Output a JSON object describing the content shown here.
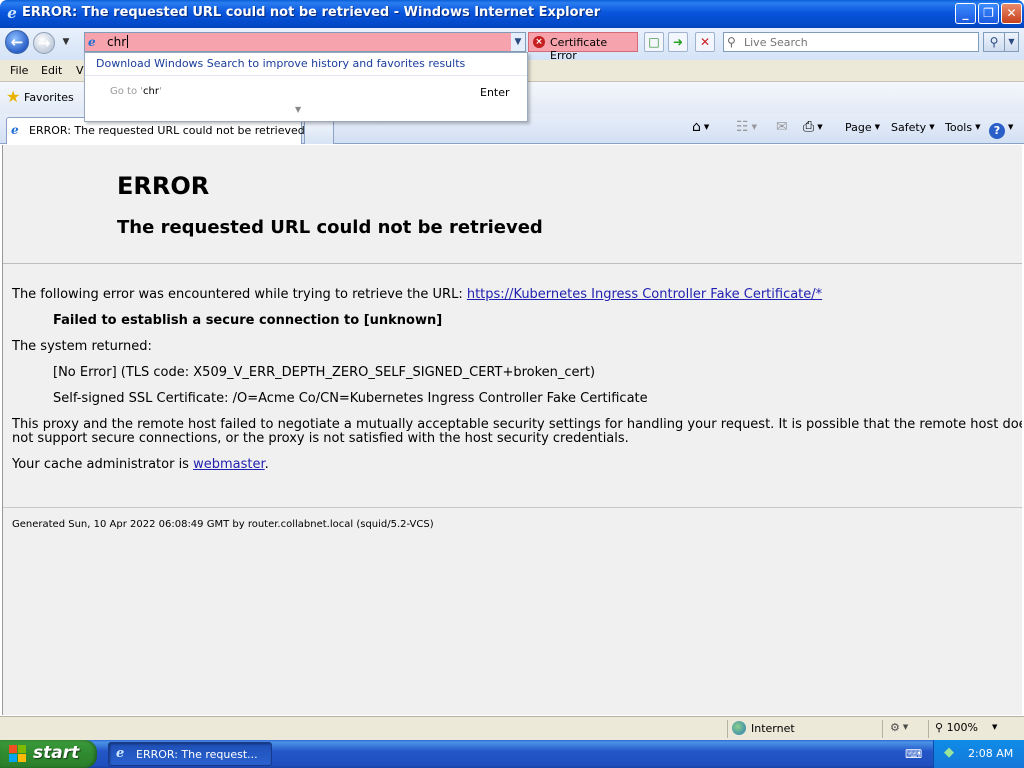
{
  "window": {
    "title": "ERROR: The requested URL could not be retrieved - Windows Internet Explorer",
    "controls": {
      "minimize": "_",
      "maximize": "❐",
      "close": "✕"
    }
  },
  "address_bar": {
    "value": "chr",
    "certificate_label": "Certificate Error"
  },
  "search": {
    "placeholder": "Live Search"
  },
  "autocomplete": {
    "hint": "Download Windows Search to improve history and favorites results",
    "goto_prefix": "Go to '",
    "goto_value": "chr",
    "goto_suffix": "'",
    "enter_label": "Enter"
  },
  "menu": {
    "file": "File",
    "edit": "Edit",
    "view": "Vi"
  },
  "favorites": {
    "label": "Favorites"
  },
  "tab": {
    "label": "ERROR: The requested URL could not be retrieved"
  },
  "command_bar": {
    "page": "Page",
    "safety": "Safety",
    "tools": "Tools"
  },
  "page": {
    "heading": "ERROR",
    "subheading": "The requested URL could not be retrieved",
    "intro": "The following error was encountered while trying to retrieve the URL: ",
    "url_link": "https://Kubernetes Ingress Controller Fake Certificate/*",
    "failure": "Failed to establish a secure connection to [unknown]",
    "system_returned": "The system returned:",
    "tls_error": "[No Error] (TLS code: X509_V_ERR_DEPTH_ZERO_SELF_SIGNED_CERT+broken_cert)",
    "self_signed": "Self-signed SSL Certificate: /O=Acme Co/CN=Kubernetes Ingress Controller Fake Certificate",
    "explanation_line1": "This proxy and the remote host failed to negotiate a mutually acceptable security settings for handling your request. It is possible that the remote host does",
    "explanation_line2": "not support secure connections, or the proxy is not satisfied with the host security credentials.",
    "admin_prefix": "Your cache administrator is ",
    "admin_link": "webmaster",
    "admin_suffix": ".",
    "generated": "Generated Sun, 10 Apr 2022 06:08:49 GMT by router.collabnet.local (squid/5.2-VCS)"
  },
  "status_bar": {
    "zone": "Internet",
    "zoom": "100%"
  },
  "taskbar": {
    "start": "start",
    "task_label": "ERROR: The request...",
    "clock": "2:08 AM"
  },
  "colors": {
    "titlebar": "#0855dd",
    "address_error_bg": "#f6a3ad",
    "link": "#1f1fb0",
    "start_green": "#2f8a2f"
  }
}
